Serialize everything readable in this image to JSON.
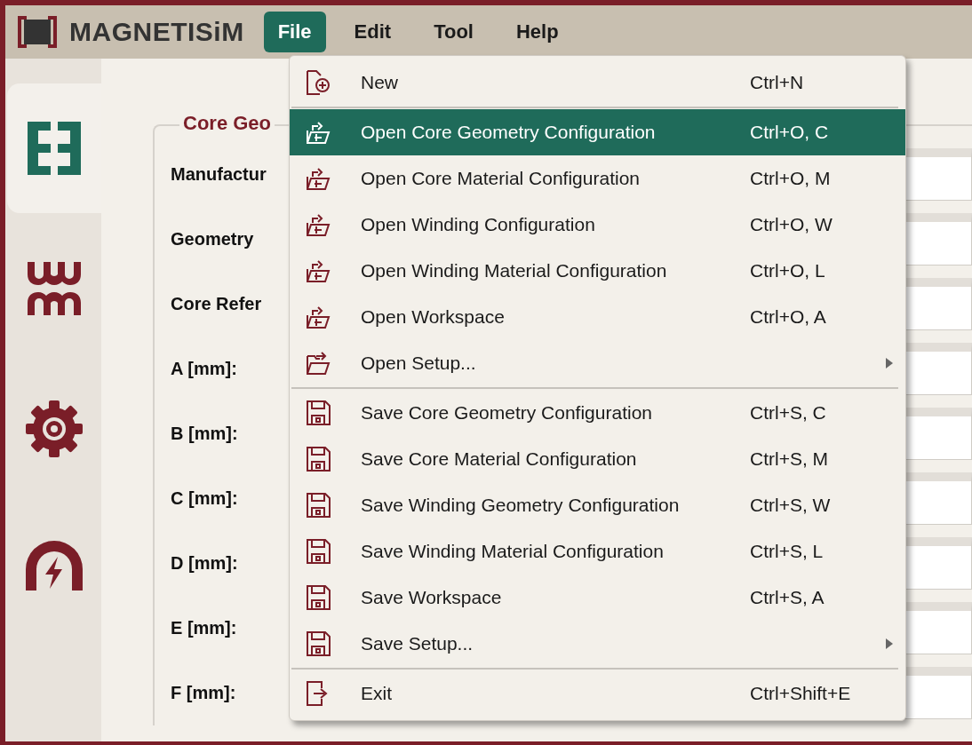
{
  "app": {
    "title": "MAGNETISiM"
  },
  "menubar": [
    {
      "label": "File",
      "selected": true
    },
    {
      "label": "Edit",
      "selected": false
    },
    {
      "label": "Tool",
      "selected": false
    },
    {
      "label": "Help",
      "selected": false
    }
  ],
  "sidebar": {
    "items": [
      {
        "kind": "core",
        "selected": true
      },
      {
        "kind": "winding",
        "selected": false
      },
      {
        "kind": "settings",
        "selected": false
      },
      {
        "kind": "magnet",
        "selected": false
      }
    ]
  },
  "form": {
    "title": "Core Geo",
    "rows": [
      {
        "label": "Manufactur"
      },
      {
        "label": "Geometry"
      },
      {
        "label": "Core Refer"
      },
      {
        "label": "A [mm]:"
      },
      {
        "label": "B [mm]:"
      },
      {
        "label": "C [mm]:"
      },
      {
        "label": "D [mm]:"
      },
      {
        "label": "E [mm]:"
      },
      {
        "label": "F [mm]:"
      }
    ]
  },
  "file_menu": {
    "items": [
      {
        "kind": "new",
        "label": "New",
        "shortcut": "Ctrl+N",
        "selected": false
      },
      {
        "kind": "separator"
      },
      {
        "kind": "open",
        "label": "Open Core Geometry Configuration",
        "shortcut": "Ctrl+O, C",
        "selected": true
      },
      {
        "kind": "open",
        "label": "Open Core Material Configuration",
        "shortcut": "Ctrl+O, M",
        "selected": false
      },
      {
        "kind": "open",
        "label": "Open Winding Configuration",
        "shortcut": "Ctrl+O, W",
        "selected": false
      },
      {
        "kind": "open",
        "label": "Open Winding Material Configuration",
        "shortcut": "Ctrl+O, L",
        "selected": false
      },
      {
        "kind": "open",
        "label": "Open Workspace",
        "shortcut": "Ctrl+O, A",
        "selected": false
      },
      {
        "kind": "folder",
        "label": "Open Setup...",
        "selected": false,
        "submenu": true
      },
      {
        "kind": "separator"
      },
      {
        "kind": "save",
        "label": "Save Core Geometry Configuration",
        "shortcut": "Ctrl+S, C",
        "selected": false
      },
      {
        "kind": "save",
        "label": "Save Core Material Configuration",
        "shortcut": "Ctrl+S, M",
        "selected": false
      },
      {
        "kind": "save",
        "label": "Save Winding Geometry Configuration",
        "shortcut": "Ctrl+S, W",
        "selected": false
      },
      {
        "kind": "save",
        "label": "Save Winding Material Configuration",
        "shortcut": "Ctrl+S, L",
        "selected": false
      },
      {
        "kind": "save",
        "label": "Save Workspace",
        "shortcut": "Ctrl+S, A",
        "selected": false
      },
      {
        "kind": "save",
        "label": "Save Setup...",
        "selected": false,
        "submenu": true
      },
      {
        "kind": "separator"
      },
      {
        "kind": "exit",
        "label": "Exit",
        "shortcut": "Ctrl+Shift+E",
        "selected": false
      }
    ]
  }
}
